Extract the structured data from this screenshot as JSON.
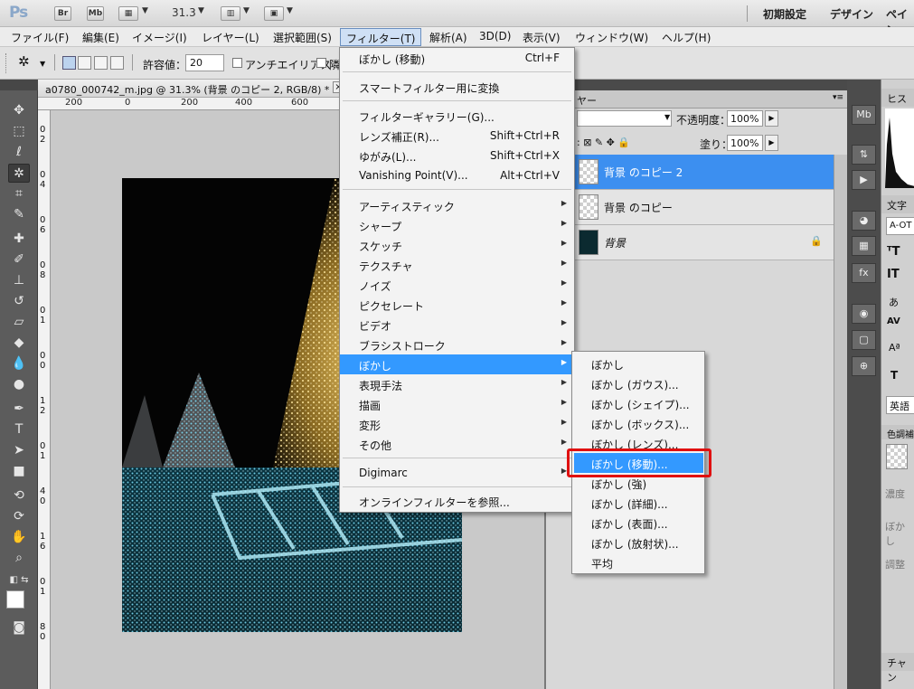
{
  "app": {
    "logo": "Ps",
    "bridge_btn": "Br",
    "minibridge_btn": "Mb",
    "zoom_value": "31.3",
    "workspaces": [
      "初期設定",
      "デザイン",
      "ペイン"
    ]
  },
  "menubar": {
    "items": [
      "ファイル(F)",
      "編集(E)",
      "イメージ(I)",
      "レイヤー(L)",
      "選択範囲(S)",
      "フィルター(T)",
      "解析(A)",
      "3D(D)",
      "表示(V)",
      "ウィンドウ(W)",
      "ヘルプ(H)"
    ],
    "active": "フィルター(T)"
  },
  "options": {
    "tolerance_label": "許容値：",
    "tolerance_value": "20",
    "antialias_label": "アンチエイリアス",
    "contiguous_label": "隣"
  },
  "document": {
    "tab_title": "a0780_000742_m.jpg @ 31.3% (背景 のコピー 2, RGB/8) *",
    "ruler_top": [
      "200",
      "0",
      "200",
      "400",
      "600"
    ],
    "ruler_left": [
      "0",
      "2",
      "0",
      "4",
      "0",
      "6",
      "0",
      "8",
      "0",
      "1",
      "0",
      "0",
      "1",
      "2",
      "0",
      "1",
      "4",
      "0",
      "1",
      "6",
      "0",
      "1",
      "8",
      "0"
    ]
  },
  "filter_menu": {
    "items": [
      {
        "label": "ぼかし (移動)",
        "shortcut": "Ctrl+F"
      },
      {
        "label": "スマートフィルター用に変換"
      },
      {
        "label": "フィルターギャラリー(G)..."
      },
      {
        "label": "レンズ補正(R)...",
        "shortcut": "Shift+Ctrl+R"
      },
      {
        "label": "ゆがみ(L)...",
        "shortcut": "Shift+Ctrl+X"
      },
      {
        "label": "Vanishing Point(V)...",
        "shortcut": "Alt+Ctrl+V"
      },
      {
        "label": "アーティスティック",
        "submenu": true
      },
      {
        "label": "シャープ",
        "submenu": true
      },
      {
        "label": "スケッチ",
        "submenu": true
      },
      {
        "label": "テクスチャ",
        "submenu": true
      },
      {
        "label": "ノイズ",
        "submenu": true
      },
      {
        "label": "ピクセレート",
        "submenu": true
      },
      {
        "label": "ビデオ",
        "submenu": true
      },
      {
        "label": "ブラシストローク",
        "submenu": true
      },
      {
        "label": "ぼかし",
        "submenu": true,
        "highlighted": true
      },
      {
        "label": "表現手法",
        "submenu": true
      },
      {
        "label": "描画",
        "submenu": true
      },
      {
        "label": "変形",
        "submenu": true
      },
      {
        "label": "その他",
        "submenu": true
      },
      {
        "label": "Digimarc",
        "submenu": true
      },
      {
        "label": "オンラインフィルターを参照..."
      }
    ]
  },
  "blur_submenu": {
    "items": [
      "ぼかし",
      "ぼかし (ガウス)...",
      "ぼかし (シェイプ)...",
      "ぼかし (ボックス)...",
      "ぼかし (レンズ)...",
      "ぼかし (移動)...",
      "ぼかし (強)",
      "ぼかし (詳細)...",
      "ぼかし (表面)...",
      "ぼかし (放射状)...",
      "平均"
    ],
    "highlighted": "ぼかし (移動)..."
  },
  "layers_panel": {
    "tab_label": "ヤー",
    "opacity_label": "不透明度：",
    "opacity_value": "100%",
    "fill_label": "塗り：",
    "fill_value": "100%",
    "layers": [
      {
        "name": "背景 のコピー 2",
        "selected": true
      },
      {
        "name": "背景 のコピー",
        "selected": false
      },
      {
        "name": "背景",
        "selected": false,
        "locked": true
      }
    ]
  },
  "right_panel": {
    "histogram_tab": "ヒスト",
    "char_tab": "文字",
    "font_value": "A-OT",
    "lang_value": "英語",
    "adjust_tab": "色調補",
    "density_label": "濃度",
    "blur_label": "ぼかし",
    "adjust_label": "調整",
    "channel_tab": "チャン"
  },
  "colors": {
    "highlight": "#3399ff",
    "callout": "#e01010",
    "selected_layer": "#3c8ff0"
  }
}
